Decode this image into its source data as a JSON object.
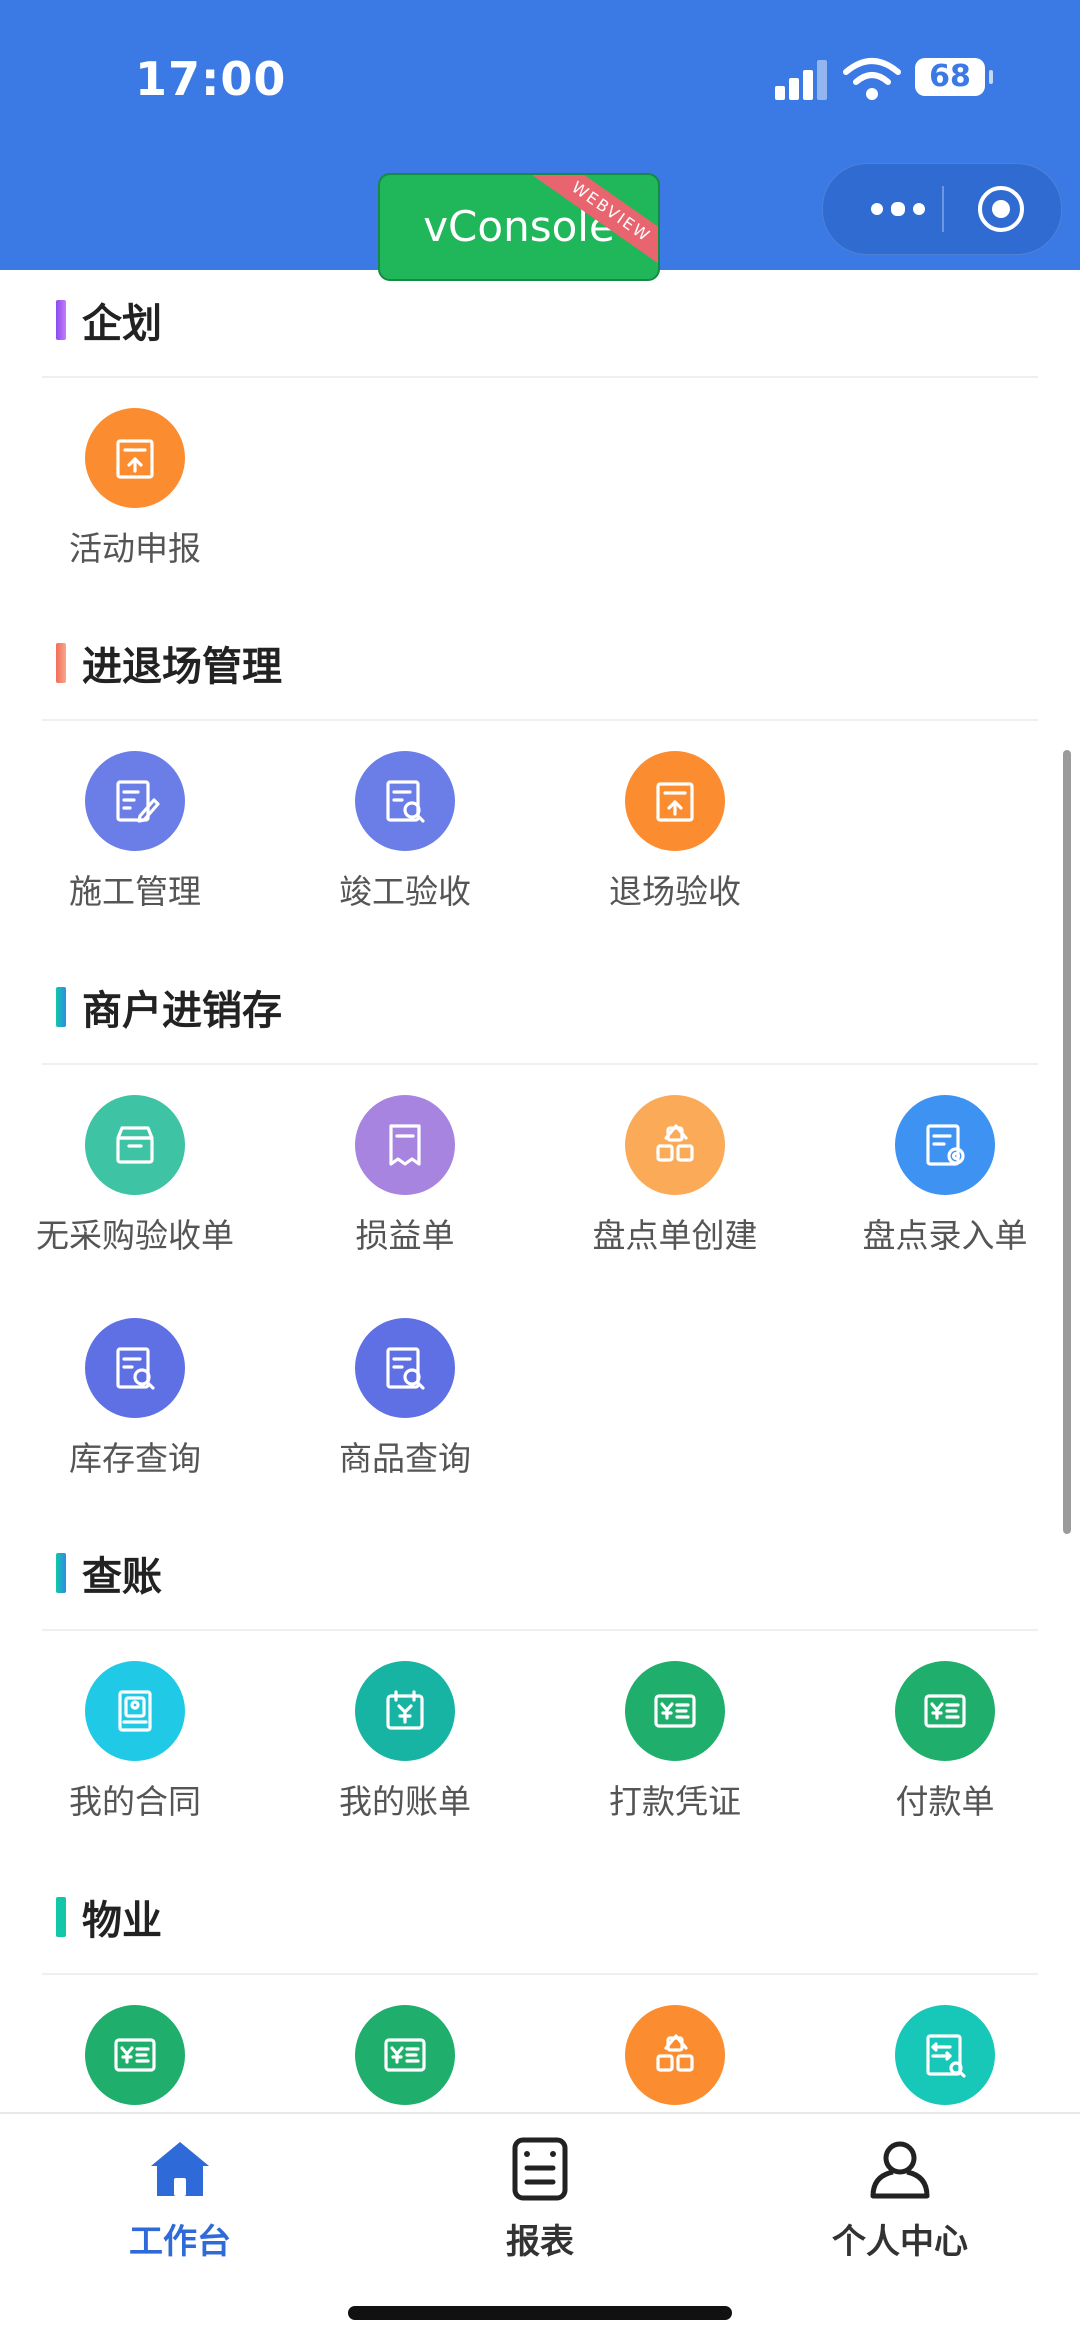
{
  "status_bar": {
    "time": "17:00",
    "battery": "68"
  },
  "vconsole": {
    "label": "vConsole",
    "ribbon": "WEBVIEW"
  },
  "sections": [
    {
      "title": "企划",
      "bar_colors": [
        "#8a4cf0",
        "#c57cf7"
      ],
      "items": [
        {
          "label": "活动申报",
          "icon": "doc-upload-icon",
          "color": "#fb8c2f"
        }
      ]
    },
    {
      "title": "进退场管理",
      "bar_colors": [
        "#f36d5a",
        "#f7a78d"
      ],
      "items": [
        {
          "label": "施工管理",
          "icon": "doc-edit-icon",
          "color": "#6b7ee8"
        },
        {
          "label": "竣工验收",
          "icon": "doc-search-icon",
          "color": "#6b7ee8"
        },
        {
          "label": "退场验收",
          "icon": "doc-upload-icon",
          "color": "#fb8c2f"
        }
      ]
    },
    {
      "title": "商户进销存",
      "bar_colors": [
        "#11c7a8",
        "#2f8be8"
      ],
      "items": [
        {
          "label": "无采购验收单",
          "icon": "box-icon",
          "color": "#3ec3a4"
        },
        {
          "label": "损益单",
          "icon": "receipt-icon",
          "color": "#a784e0"
        },
        {
          "label": "盘点单创建",
          "icon": "blocks-icon",
          "color": "#fbaa57"
        },
        {
          "label": "盘点录入单",
          "icon": "doc-gear-icon",
          "color": "#3d92f2"
        },
        {
          "label": "库存查询",
          "icon": "doc-search-icon",
          "color": "#5f6fe4"
        },
        {
          "label": "商品查询",
          "icon": "doc-search-icon",
          "color": "#5f6fe4"
        }
      ]
    },
    {
      "title": "查账",
      "bar_colors": [
        "#11c7a8",
        "#2f8be8"
      ],
      "items": [
        {
          "label": "我的合同",
          "icon": "contract-icon",
          "color": "#20c9e6"
        },
        {
          "label": "我的账单",
          "icon": "bill-icon",
          "color": "#17b4a4"
        },
        {
          "label": "打款凭证",
          "icon": "yen-doc-icon",
          "color": "#1fae6b"
        },
        {
          "label": "付款单",
          "icon": "yen-doc-icon",
          "color": "#1fae6b"
        }
      ]
    },
    {
      "title": "物业",
      "bar_colors": [
        "#11c7a8",
        "#11c7a8"
      ],
      "items": [
        {
          "label": "",
          "icon": "yen-doc-icon",
          "color": "#1fae6b"
        },
        {
          "label": "",
          "icon": "yen-doc-icon",
          "color": "#1fae6b"
        },
        {
          "label": "",
          "icon": "blocks-icon",
          "color": "#fb8c2f"
        },
        {
          "label": "",
          "icon": "transfer-search-icon",
          "color": "#17c7b7"
        }
      ]
    }
  ],
  "tabs": [
    {
      "label": "工作台",
      "icon": "home-icon",
      "active": true
    },
    {
      "label": "报表",
      "icon": "report-icon",
      "active": false
    },
    {
      "label": "个人中心",
      "icon": "user-icon",
      "active": false
    }
  ]
}
